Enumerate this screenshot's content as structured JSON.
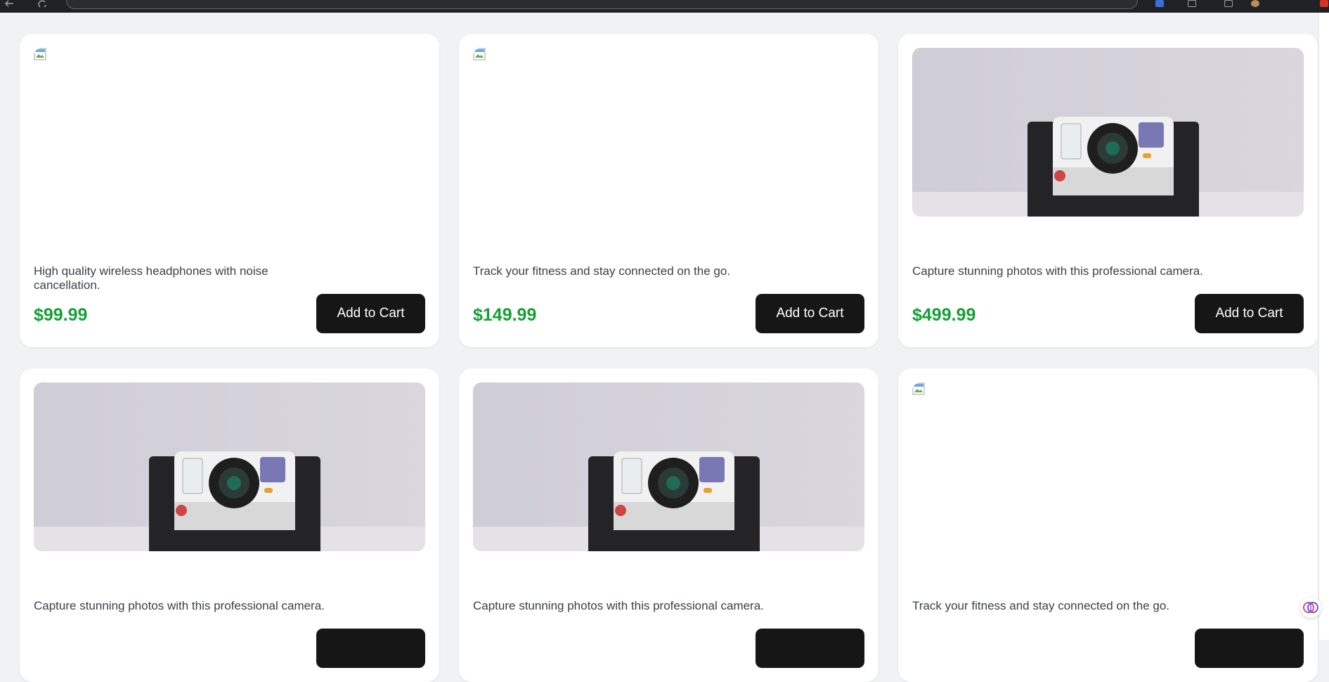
{
  "icons": {
    "back": "arrow-left-icon",
    "reload": "reload-icon",
    "bookmark": "star-icon",
    "extension": "extension-icon",
    "assistant": "brain-icon"
  },
  "colors": {
    "page_bg": "#f1f2f4",
    "card_bg": "#ffffff",
    "price": "#15a035",
    "button_bg": "#161616",
    "button_text": "#ffffff"
  },
  "products": [
    {
      "description": "High quality wireless headphones with noise cancellation.",
      "price": "$99.99",
      "button_label": "Add to Cart",
      "image": "broken"
    },
    {
      "description": "Track your fitness and stay connected on the go.",
      "price": "$149.99",
      "button_label": "Add to Cart",
      "image": "broken"
    },
    {
      "description": "Capture stunning photos with this professional camera.",
      "price": "$499.99",
      "button_label": "Add to Cart",
      "image": "camera"
    },
    {
      "description": "Capture stunning photos with this professional camera.",
      "price": "",
      "button_label": "",
      "image": "camera"
    },
    {
      "description": "Capture stunning photos with this professional camera.",
      "price": "",
      "button_label": "",
      "image": "camera"
    },
    {
      "description": "Track your fitness and stay connected on the go.",
      "price": "",
      "button_label": "",
      "image": "broken"
    }
  ]
}
